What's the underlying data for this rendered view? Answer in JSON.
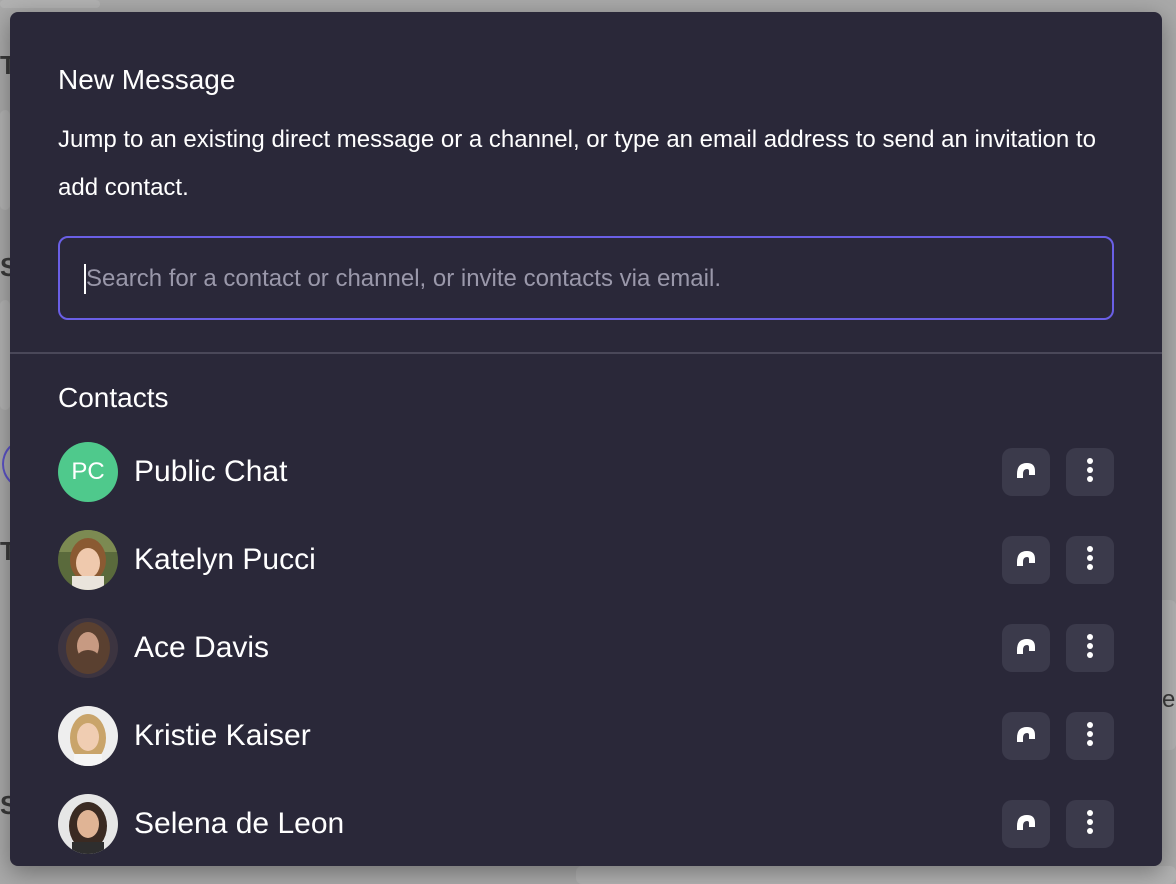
{
  "modal": {
    "title": "New Message",
    "description": "Jump to an existing direct message or a channel, or type an email address to send an invitation to add contact.",
    "search_placeholder": "Search for a contact or channel, or invite contacts via email.",
    "search_value": ""
  },
  "contacts_section": {
    "label": "Contacts",
    "items": [
      {
        "name": "Public Chat",
        "avatar": "initials",
        "initials": "PC",
        "avatar_color": "#4fc98c",
        "call_icon": "call-icon",
        "more_icon": "more-vertical-icon"
      },
      {
        "name": "Katelyn Pucci",
        "avatar": "photo",
        "call_icon": "call-icon",
        "more_icon": "more-vertical-icon"
      },
      {
        "name": "Ace Davis",
        "avatar": "photo",
        "call_icon": "call-icon",
        "more_icon": "more-vertical-icon"
      },
      {
        "name": "Kristie Kaiser",
        "avatar": "photo",
        "call_icon": "call-icon",
        "more_icon": "more-vertical-icon"
      },
      {
        "name": "Selena de Leon",
        "avatar": "photo",
        "call_icon": "call-icon",
        "more_icon": "more-vertical-icon"
      }
    ]
  },
  "colors": {
    "modal_background": "#2a2839",
    "accent": "#6a5fe6",
    "button_background": "#3b3a4b",
    "public_chat_avatar": "#4fc98c"
  }
}
